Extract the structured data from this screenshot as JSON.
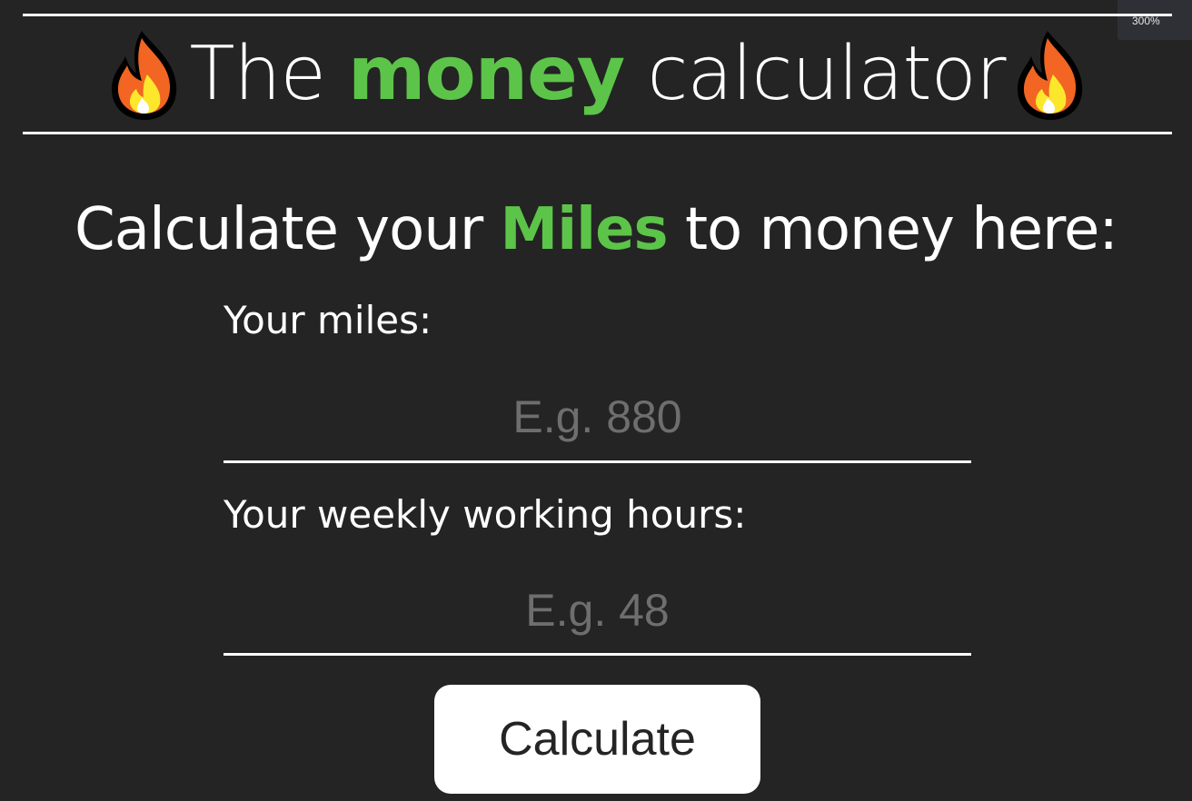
{
  "browser": {
    "zoom_level": "300%"
  },
  "header": {
    "title_prefix": "The ",
    "title_highlight": "money",
    "title_suffix": " calculator",
    "flame_icon": "fire-emoji"
  },
  "subtitle": {
    "prefix": "Calculate your ",
    "highlight": "Miles",
    "suffix": " to money here:"
  },
  "form": {
    "miles_label": "Your miles:",
    "miles_value": "",
    "miles_placeholder": "E.g. 880",
    "hours_label": "Your weekly working hours:",
    "hours_value": "",
    "hours_placeholder": "E.g. 48",
    "calculate_label": "Calculate"
  },
  "colors": {
    "background": "#242424",
    "accent_green": "#5cc449",
    "text": "#ffffff",
    "placeholder": "#6e6e6e"
  }
}
